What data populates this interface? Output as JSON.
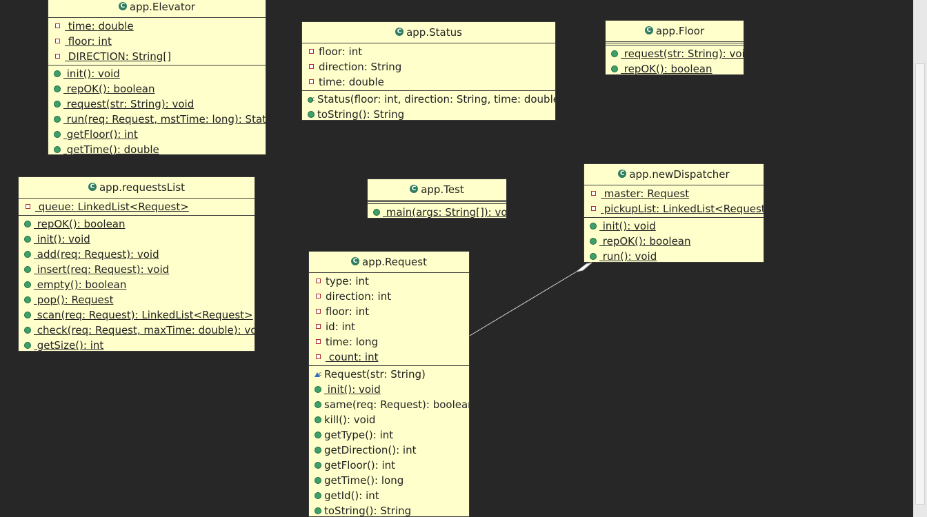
{
  "classes": {
    "elevator": {
      "name": "app.Elevator",
      "fields": [
        {
          "text": " time: double",
          "vis": "private",
          "static": true
        },
        {
          "text": " floor: int",
          "vis": "private",
          "static": true
        },
        {
          "text": " DIRECTION: String[]",
          "vis": "private",
          "static": true
        }
      ],
      "methods": [
        {
          "text": " init(): void",
          "vis": "public",
          "static": true
        },
        {
          "text": " repOK(): boolean",
          "vis": "public",
          "static": true
        },
        {
          "text": " request(str: String): void",
          "vis": "public",
          "static": true
        },
        {
          "text": " run(req: Request, mstTime: long): Status",
          "vis": "public",
          "static": true
        },
        {
          "text": " getFloor(): int",
          "vis": "public",
          "static": true
        },
        {
          "text": " getTime(): double",
          "vis": "public",
          "static": true
        }
      ]
    },
    "status": {
      "name": "app.Status",
      "fields": [
        {
          "text": "floor: int",
          "vis": "private"
        },
        {
          "text": "direction: String",
          "vis": "private"
        },
        {
          "text": "time: double",
          "vis": "private"
        }
      ],
      "methods": [
        {
          "text": "Status(floor: int, direction: String, time: double)",
          "vis": "constructor"
        },
        {
          "text": "toString(): String",
          "vis": "public"
        }
      ]
    },
    "floor": {
      "name": "app.Floor",
      "methods": [
        {
          "text": " request(str: String): void",
          "vis": "public",
          "static": true
        },
        {
          "text": " repOK(): boolean",
          "vis": "public",
          "static": true
        }
      ]
    },
    "requests_list": {
      "name": "app.requestsList",
      "fields": [
        {
          "text": " queue: LinkedList<Request> ",
          "vis": "private",
          "static": true
        }
      ],
      "methods": [
        {
          "text": " repOK(): boolean",
          "vis": "public",
          "static": true
        },
        {
          "text": " init(): void",
          "vis": "public",
          "static": true
        },
        {
          "text": " add(req: Request): void",
          "vis": "public",
          "static": true
        },
        {
          "text": " insert(req: Request): void",
          "vis": "public",
          "static": true
        },
        {
          "text": " empty(): boolean",
          "vis": "public",
          "static": true
        },
        {
          "text": " pop(): Request",
          "vis": "public",
          "static": true
        },
        {
          "text": " scan(req: Request): LinkedList<Request> ",
          "vis": "public",
          "static": true
        },
        {
          "text": " check(req: Request, maxTime: double): void",
          "vis": "public",
          "static": true
        },
        {
          "text": " getSize(): int",
          "vis": "public",
          "static": true
        }
      ]
    },
    "test": {
      "name": "app.Test",
      "methods": [
        {
          "text": " main(args: String[]): void",
          "vis": "public",
          "static": true
        }
      ]
    },
    "new_dispatcher": {
      "name": "app.newDispatcher",
      "fields": [
        {
          "text": " master: Request",
          "vis": "private",
          "static": true
        },
        {
          "text": " pickupList: LinkedList<Request>",
          "vis": "private",
          "static": true
        }
      ],
      "methods": [
        {
          "text": " init(): void",
          "vis": "public",
          "static": true
        },
        {
          "text": " repOK(): boolean",
          "vis": "public",
          "static": true
        },
        {
          "text": " run(): void",
          "vis": "public",
          "static": true
        }
      ]
    },
    "request": {
      "name": "app.Request",
      "fields": [
        {
          "text": "type: int",
          "vis": "private"
        },
        {
          "text": "direction: int",
          "vis": "private"
        },
        {
          "text": "floor: int",
          "vis": "private"
        },
        {
          "text": "id: int",
          "vis": "private"
        },
        {
          "text": "time: long",
          "vis": "private"
        },
        {
          "text": " count: int",
          "vis": "private",
          "static": true
        }
      ],
      "methods": [
        {
          "text": "Request(str: String)",
          "vis": "package-constructor"
        },
        {
          "text": " init(): void",
          "vis": "public",
          "static": true
        },
        {
          "text": "same(req: Request): boolean",
          "vis": "public"
        },
        {
          "text": "kill(): void",
          "vis": "public"
        },
        {
          "text": "getType(): int",
          "vis": "public"
        },
        {
          "text": "getDirection(): int",
          "vis": "public"
        },
        {
          "text": "getFloor(): int",
          "vis": "public"
        },
        {
          "text": "getTime(): long",
          "vis": "public"
        },
        {
          "text": "getId(): int",
          "vis": "public"
        },
        {
          "text": "toString(): String",
          "vis": "public"
        }
      ]
    }
  },
  "connections": [
    {
      "from": "request",
      "to": "new_dispatcher",
      "kind": "composition"
    }
  ],
  "colors": {
    "background": "#272727",
    "class_fill": "#ffffcc",
    "class_icon": "#2f7d60",
    "public_icon": "#3ea06a",
    "private_icon": "#b03030"
  }
}
